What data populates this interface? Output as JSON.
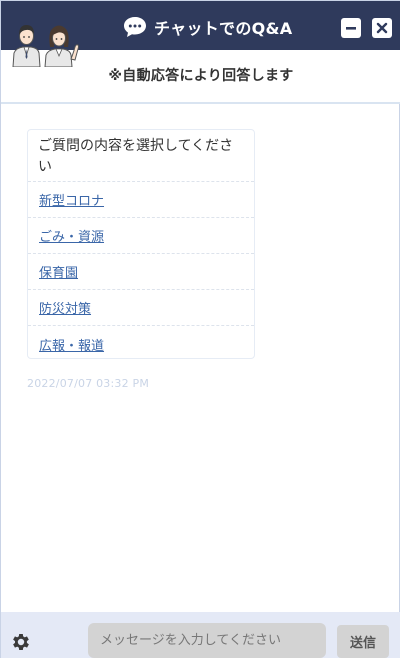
{
  "header": {
    "title": "チャットでのQ&A",
    "subtitle": "※自動応答により回答します"
  },
  "message": {
    "question": "ご質問の内容を選択してください",
    "options": [
      {
        "label": "新型コロナ"
      },
      {
        "label": "ごみ・資源"
      },
      {
        "label": "保育園"
      },
      {
        "label": "防災対策"
      },
      {
        "label": "広報・報道"
      }
    ],
    "timestamp": "2022/07/07 03:32 PM"
  },
  "footer": {
    "input_placeholder": "メッセージを入力してください",
    "send_label": "送信"
  },
  "colors": {
    "titlebar": "#2f3a5c",
    "footer": "#e4e9f6",
    "link": "#3a66a8"
  },
  "icons": {
    "chat": "chat-bubble-icon",
    "minimize": "minimize-icon",
    "close": "close-icon",
    "settings": "gear-icon",
    "staff": "staff-avatars-icon"
  }
}
